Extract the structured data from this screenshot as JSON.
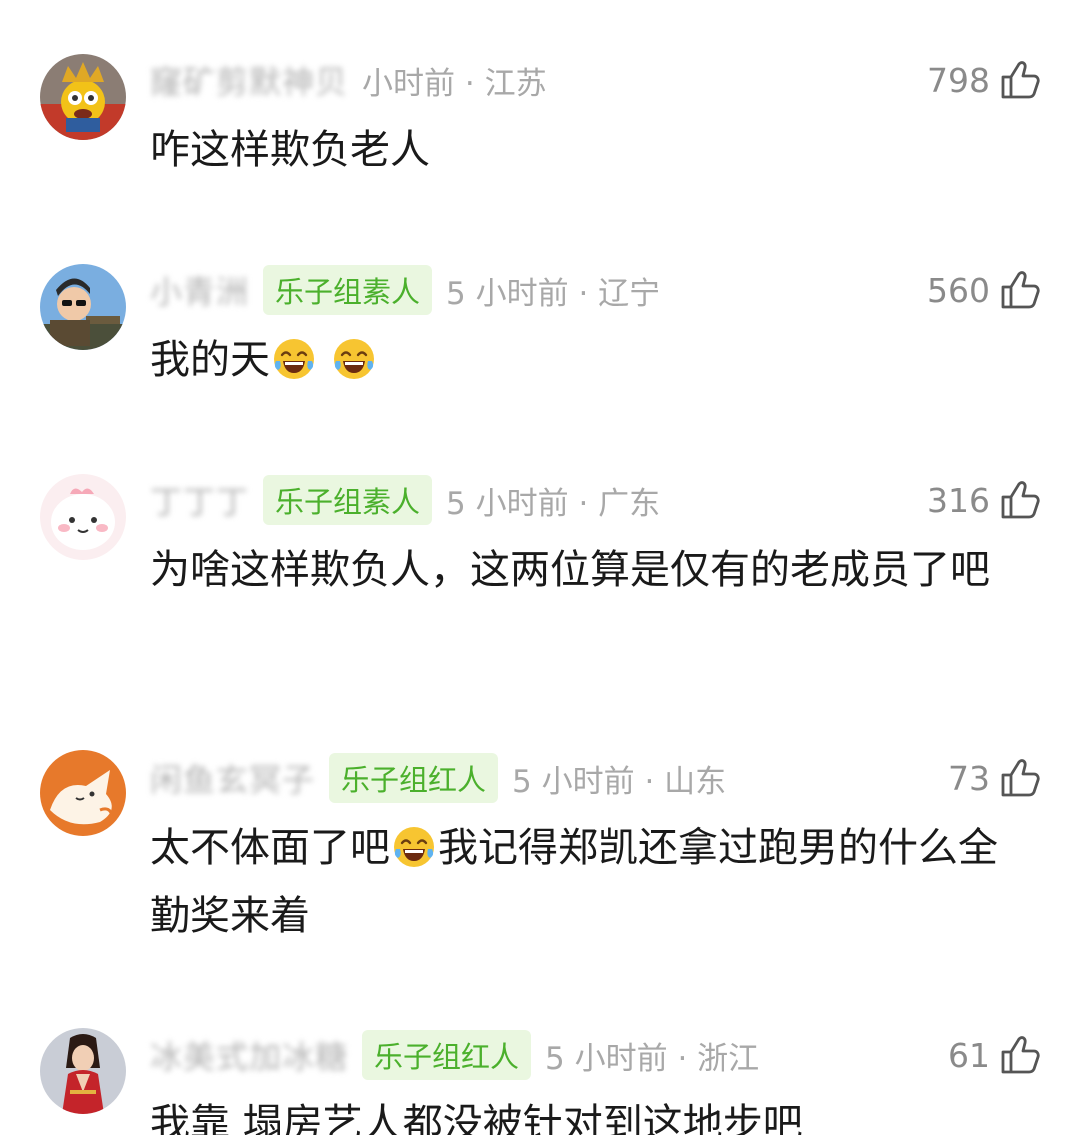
{
  "comments": [
    {
      "username": "窿矿剪默神贝",
      "badge": "",
      "time_location": "小时前 · 江苏",
      "likes": "798",
      "text_segments": [
        "咋这样欺负老人"
      ],
      "avatar": "crowned-cartoon-avatar"
    },
    {
      "username": "小青洲",
      "badge": "乐子组素人",
      "time_location": "5 小时前 · 辽宁",
      "likes": "560",
      "text_segments": [
        "我的天",
        "",
        ""
      ],
      "avatar": "sunglasses-cartoon-avatar"
    },
    {
      "username": "丁丁丁",
      "badge": "乐子组素人",
      "time_location": "5 小时前 · 广东",
      "likes": "316",
      "text_segments": [
        "为啥这样欺负人，这两位算是仅有的老成员了吧"
      ],
      "avatar": "pink-pig-avatar"
    },
    {
      "username": "闲鱼玄冥子",
      "badge": "乐子组红人",
      "time_location": "5 小时前 · 山东",
      "likes": "73",
      "text_segments": [
        "太不体面了吧",
        "我记得郑凯还拿过跑男的什么全勤奖来着"
      ],
      "avatar": "orange-cat-avatar"
    },
    {
      "username": "冰美式加冰糖",
      "badge": "乐子组红人",
      "time_location": "5 小时前 · 浙江",
      "likes": "61",
      "text_segments": [
        "我靠 塌房艺人都没被针对到这地步吧"
      ],
      "avatar": "red-costume-avatar"
    }
  ],
  "icons": {
    "like": "thumbs-up-icon",
    "emoji": "tears-of-joy-emoji-icon"
  },
  "colors": {
    "badge_bg": "#eaf7e0",
    "badge_text": "#4bb02c",
    "meta_text": "#a8a8a8",
    "body_text": "#1a1a1a"
  }
}
